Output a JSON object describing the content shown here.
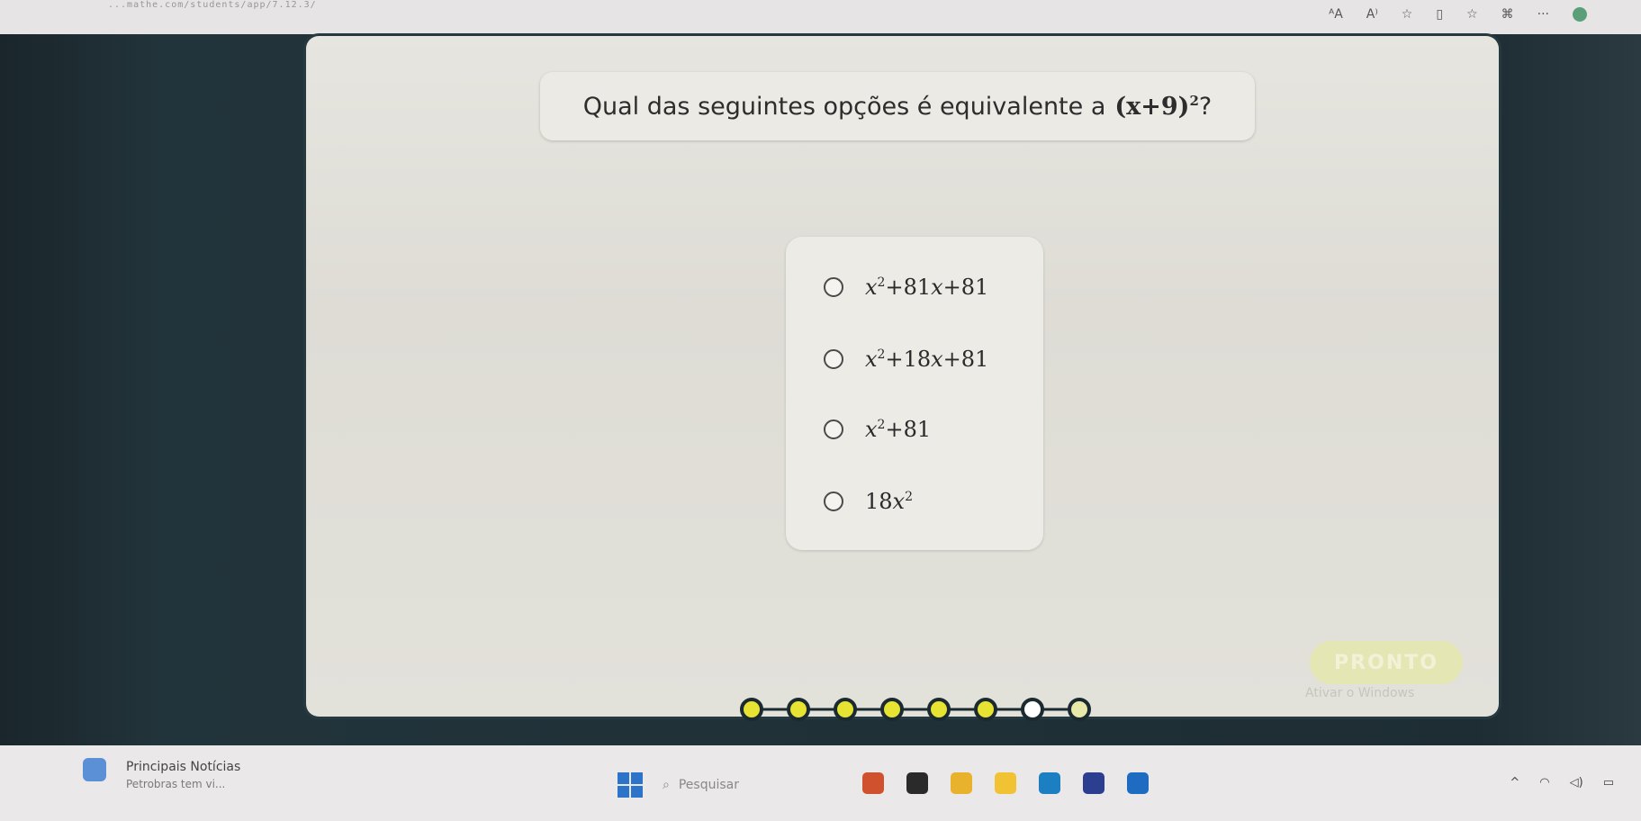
{
  "browser": {
    "address": "...mathe.com/students/app/7.12.3/",
    "icons": [
      "text-size-icon",
      "read-aloud-icon",
      "favorite-icon",
      "split-screen-icon",
      "collections-icon",
      "extensions-icon",
      "more-icon"
    ]
  },
  "question": {
    "text": "Qual das seguintes opções é equivalente a",
    "expr_base": "(x+9)",
    "expr_exp": "2",
    "suffix": "?"
  },
  "options": [
    {
      "parts": [
        {
          "t": "x",
          "i": true
        },
        {
          "t": "2",
          "sup": true
        },
        {
          "t": "+81"
        },
        {
          "t": "x",
          "i": true
        },
        {
          "t": "+81"
        }
      ]
    },
    {
      "parts": [
        {
          "t": "x",
          "i": true
        },
        {
          "t": "2",
          "sup": true
        },
        {
          "t": "+18"
        },
        {
          "t": "x",
          "i": true
        },
        {
          "t": "+81"
        }
      ]
    },
    {
      "parts": [
        {
          "t": "x",
          "i": true
        },
        {
          "t": "2",
          "sup": true
        },
        {
          "t": "+81"
        }
      ]
    },
    {
      "parts": [
        {
          "t": "18"
        },
        {
          "t": "x",
          "i": true
        },
        {
          "t": "2",
          "sup": true
        }
      ]
    }
  ],
  "button": {
    "label": "PRONTO"
  },
  "watermark": "Ativar o Windows",
  "progress": {
    "total": 8,
    "completed": 6,
    "current": 7,
    "colors": {
      "done": "#e6e332",
      "current": "#ffffff",
      "pending": "#e8e8a8",
      "line": "#1b2a30"
    }
  },
  "taskbar": {
    "news_title": "Principais Notícias",
    "news_sub": "Petrobras tem vi...",
    "search_placeholder": "Pesquisar",
    "apps": [
      {
        "name": "widgets-app-icon",
        "color": "#d0512e"
      },
      {
        "name": "terminal-app-icon",
        "color": "#2a2a2a"
      },
      {
        "name": "chrome-app-icon",
        "color": "#e8b22c"
      },
      {
        "name": "file-explorer-app-icon",
        "color": "#f0c234"
      },
      {
        "name": "edge-app-icon",
        "color": "#1b7fc2"
      },
      {
        "name": "store-app-icon",
        "color": "#2c3e8f"
      },
      {
        "name": "outlook-app-icon",
        "color": "#1e6bc2"
      }
    ]
  }
}
